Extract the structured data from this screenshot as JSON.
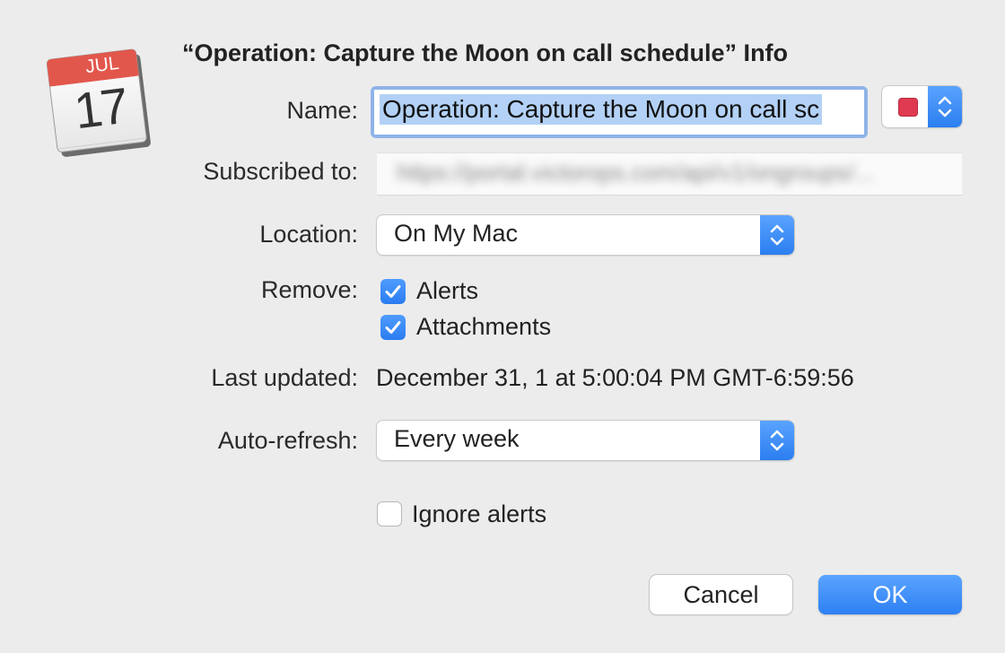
{
  "dialog": {
    "title": "“Operation: Capture the Moon on call schedule” Info",
    "icon": {
      "name": "calendar-icon",
      "month": "JUL",
      "day": "17",
      "accent": "#e2574c"
    }
  },
  "fields": {
    "name_label": "Name:",
    "name_value": "Operation: Capture the Moon on call sc",
    "color": "#e03a52",
    "subscribed_label": "Subscribed to:",
    "subscribed_value": "https://portal.victorops.com/api/v1/ongroups/...",
    "location_label": "Location:",
    "location_value": "On My Mac",
    "remove_label": "Remove:",
    "remove_options": [
      {
        "label": "Alerts",
        "checked": true
      },
      {
        "label": "Attachments",
        "checked": true
      }
    ],
    "last_updated_label": "Last updated:",
    "last_updated_value": "December 31, 1 at 5:00:04 PM GMT-6:59:56",
    "autorefresh_label": "Auto-refresh:",
    "autorefresh_value": "Every week",
    "ignore_alerts": {
      "label": "Ignore alerts",
      "checked": false
    }
  },
  "buttons": {
    "cancel": "Cancel",
    "ok": "OK"
  },
  "colors": {
    "accent": "#2b7ef0",
    "background": "#ececec"
  }
}
